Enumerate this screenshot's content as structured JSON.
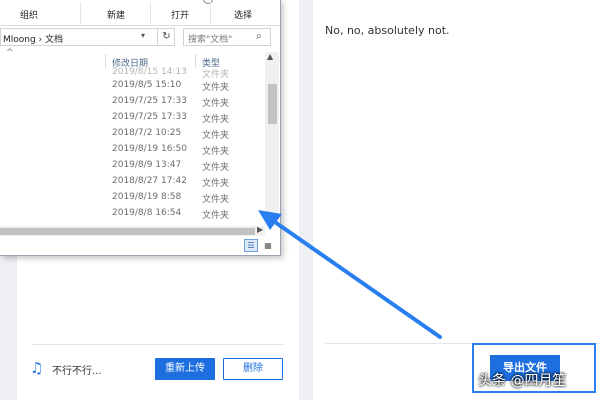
{
  "explorer": {
    "ribbon": [
      "组织",
      "新建",
      "打开",
      "选择"
    ],
    "address_text": "Mloong › 文档",
    "refresh_glyph": "↻",
    "search_placeholder": "搜索\"文档\"",
    "columns": {
      "date": "修改日期",
      "type": "类型"
    },
    "rows": [
      {
        "date": "2019/8/5 15:10",
        "type": "文件夹"
      },
      {
        "date": "2019/7/25 17:33",
        "type": "文件夹"
      },
      {
        "date": "2019/7/25 17:33",
        "type": "文件夹"
      },
      {
        "date": "2018/7/2 10:25",
        "type": "文件夹"
      },
      {
        "date": "2019/8/19 16:50",
        "type": "文件夹"
      },
      {
        "date": "2019/8/9 13:47",
        "type": "文件夹"
      },
      {
        "date": "2018/8/27 17:42",
        "type": "文件夹"
      },
      {
        "date": "2019/8/19 8:58",
        "type": "文件夹"
      },
      {
        "date": "2019/8/8 16:54",
        "type": "文件夹"
      }
    ]
  },
  "file_item": {
    "name": "不行不行...",
    "reupload_label": "重新上传",
    "delete_label": "删除"
  },
  "result": {
    "text": "No, no, absolutely not.",
    "export_label": "导出文件"
  },
  "watermark": "头条 @四月笙",
  "colors": {
    "primary": "#1d6fe0",
    "annotation": "#2a7ff0"
  },
  "icons": {
    "file": "music-note-icon",
    "search": "search-icon",
    "refresh": "refresh-icon"
  }
}
